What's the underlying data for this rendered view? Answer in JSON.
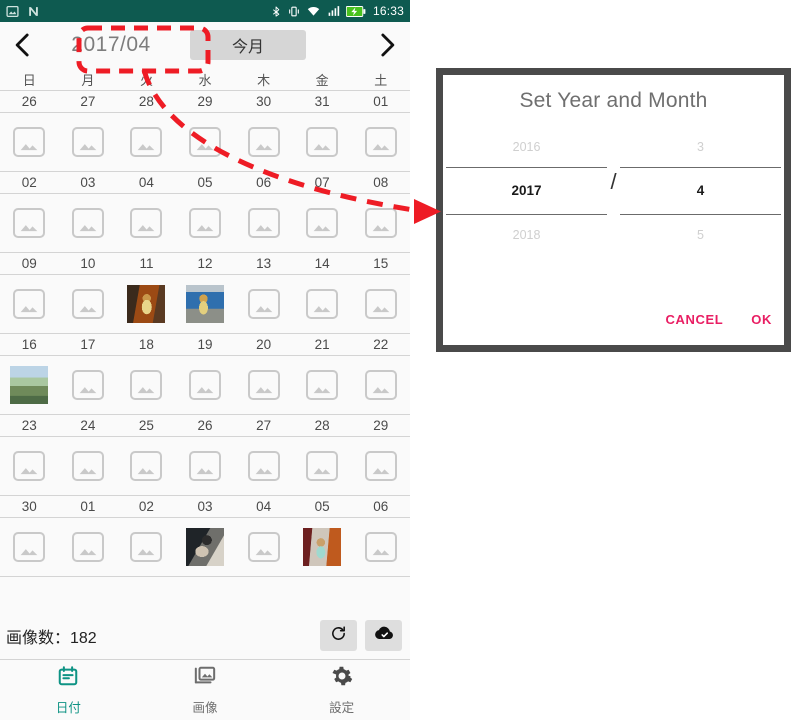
{
  "statusbar": {
    "icons": [
      "image-icon",
      "android-n-logo",
      "bluetooth-icon",
      "vibrate-icon",
      "wifi-icon",
      "signal-icon",
      "battery-charging-icon"
    ],
    "clock": "16:33"
  },
  "header": {
    "prev_label": "‹",
    "next_label": "›",
    "year_month": "2017/04",
    "today_button": "今月"
  },
  "calendar": {
    "weekdays": [
      "日",
      "月",
      "火",
      "水",
      "木",
      "金",
      "土"
    ],
    "weeks": [
      {
        "days": [
          "26",
          "27",
          "28",
          "29",
          "30",
          "31",
          "01"
        ],
        "thumbs": [
          "",
          "",
          "",
          "",
          "",
          "",
          ""
        ]
      },
      {
        "days": [
          "02",
          "03",
          "04",
          "05",
          "06",
          "07",
          "08"
        ],
        "thumbs": [
          "",
          "",
          "",
          "",
          "",
          "",
          ""
        ]
      },
      {
        "days": [
          "09",
          "10",
          "11",
          "12",
          "13",
          "14",
          "15"
        ],
        "thumbs": [
          "",
          "",
          "th-a",
          "th-b",
          "",
          "",
          ""
        ]
      },
      {
        "days": [
          "16",
          "17",
          "18",
          "19",
          "20",
          "21",
          "22"
        ],
        "thumbs": [
          "th-c",
          "",
          "",
          "",
          "",
          "",
          ""
        ]
      },
      {
        "days": [
          "23",
          "24",
          "25",
          "26",
          "27",
          "28",
          "29"
        ],
        "thumbs": [
          "",
          "",
          "",
          "",
          "",
          "",
          ""
        ]
      },
      {
        "days": [
          "30",
          "01",
          "02",
          "03",
          "04",
          "05",
          "06"
        ],
        "thumbs": [
          "",
          "",
          "",
          "th-d",
          "",
          "th-e",
          ""
        ]
      }
    ]
  },
  "summary": {
    "image_count_label": "画像数：182",
    "refresh_icon": "refresh-icon",
    "cloud_done_icon": "cloud-done-icon"
  },
  "tabbar": {
    "tabs": [
      {
        "label": "日付",
        "icon": "calendar-icon",
        "active": true
      },
      {
        "label": "画像",
        "icon": "photo-icon",
        "active": false
      },
      {
        "label": "設定",
        "icon": "gear-icon",
        "active": false
      }
    ]
  },
  "dialog": {
    "title": "Set Year and Month",
    "year": {
      "above": "2016",
      "selected": "2017",
      "below": "2018"
    },
    "separator": "/",
    "month": {
      "above": "3",
      "selected": "4",
      "below": "5"
    },
    "cancel": "CANCEL",
    "ok": "OK"
  },
  "annotation": {
    "highlight_target": "2017/04",
    "arrow_color": "#ee1c25"
  },
  "colors": {
    "statusbar_bg": "#0e5a50",
    "accent_teal": "#0e9384",
    "dialog_action": "#e91e63",
    "annotation_red": "#ee1c25",
    "page_bg": "#fafafa"
  }
}
